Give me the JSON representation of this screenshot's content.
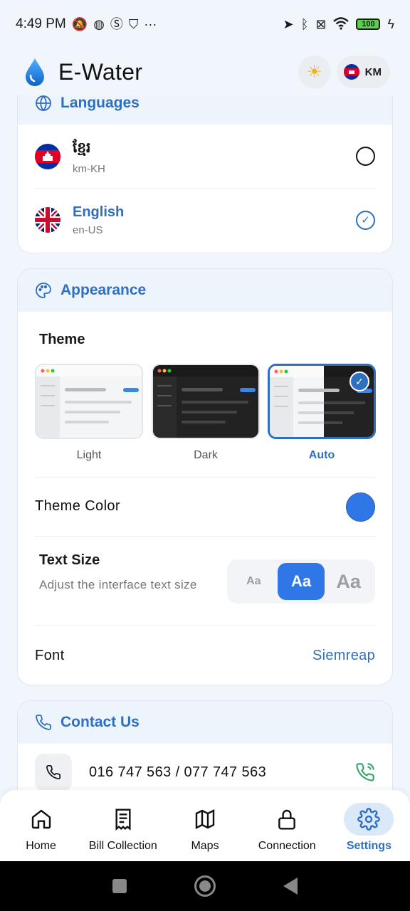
{
  "status_bar": {
    "time": "4:49 PM",
    "battery": "100"
  },
  "header": {
    "title": "E-Water",
    "language_code": "KM"
  },
  "languages": {
    "title": "Languages",
    "items": [
      {
        "name": "ខ្មែរ",
        "code": "km-KH",
        "selected": false
      },
      {
        "name": "English",
        "code": "en-US",
        "selected": true
      }
    ]
  },
  "appearance": {
    "title": "Appearance",
    "theme_label": "Theme",
    "themes": [
      {
        "label": "Light",
        "selected": false
      },
      {
        "label": "Dark",
        "selected": false
      },
      {
        "label": "Auto",
        "selected": true
      }
    ],
    "theme_color_label": "Theme Color",
    "theme_color": "#2f77e6",
    "text_size_label": "Text Size",
    "text_size_desc": "Adjust the interface text size",
    "text_size_options": [
      "Aa",
      "Aa",
      "Aa"
    ],
    "text_size_selected": 1,
    "font_label": "Font",
    "font_value": "Siemreap"
  },
  "contact": {
    "title": "Contact Us",
    "phone": "016 747 563  /  077 747 563"
  },
  "bottom_nav": {
    "items": [
      {
        "label": "Home",
        "icon": "home-icon"
      },
      {
        "label": "Bill Collection",
        "icon": "receipt-icon"
      },
      {
        "label": "Maps",
        "icon": "map-icon"
      },
      {
        "label": "Connection",
        "icon": "lock-icon"
      },
      {
        "label": "Settings",
        "icon": "gear-icon",
        "active": true
      }
    ]
  },
  "colors": {
    "accent": "#2f6fbf",
    "primary": "#2f77e6",
    "background": "#f1f6fc"
  }
}
